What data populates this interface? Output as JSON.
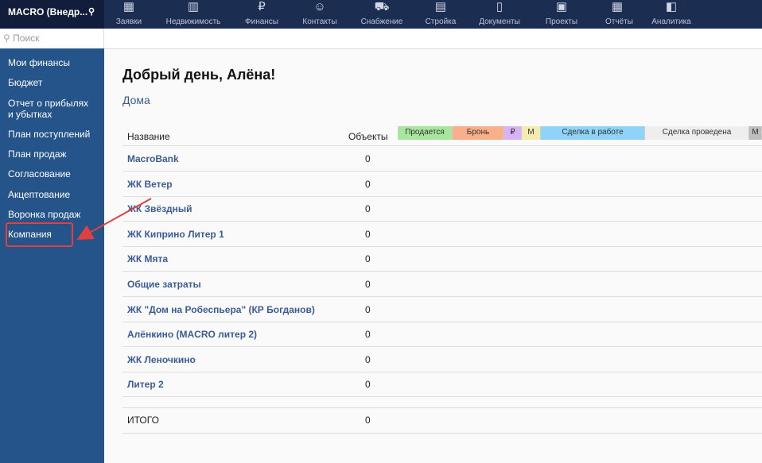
{
  "app": {
    "title": "MACRO (Внедр...",
    "pin_icon": "pin-icon"
  },
  "nav": [
    {
      "label": "Заявки",
      "icon": "grid-icon",
      "glyph": "▦"
    },
    {
      "label": "Недвижимость",
      "icon": "building-icon",
      "glyph": "▥"
    },
    {
      "label": "Финансы",
      "icon": "ruble-icon",
      "glyph": "₽"
    },
    {
      "label": "Контакты",
      "icon": "contacts-icon",
      "glyph": "☺"
    },
    {
      "label": "Снабжение",
      "icon": "truck-icon",
      "glyph": "⛟"
    },
    {
      "label": "Стройка",
      "icon": "bricks-icon",
      "glyph": "▤"
    },
    {
      "label": "Документы",
      "icon": "documents-icon",
      "glyph": "▯"
    },
    {
      "label": "Проекты",
      "icon": "blueprint-icon",
      "glyph": "▣"
    },
    {
      "label": "Отчёты",
      "icon": "reports-icon",
      "glyph": "▦"
    },
    {
      "label": "Аналитика",
      "icon": "analytics-icon",
      "glyph": "◧"
    }
  ],
  "search": {
    "placeholder": "Поиск"
  },
  "sidebar": [
    "Мои финансы",
    "Бюджет",
    "Отчет о прибылях\nи убытках",
    "План поступлений",
    "План продаж",
    "Согласование",
    "Акцептование",
    "Воронка продаж",
    "Компания"
  ],
  "greeting": "Добрый день, Алёна!",
  "section": "Дома",
  "table": {
    "col_name": "Название",
    "col_objects": "Объекты",
    "rows": [
      {
        "name": "MacroBank",
        "value": "0"
      },
      {
        "name": "ЖК Ветер",
        "value": "0"
      },
      {
        "name": "ЖК Звёздный",
        "value": "0"
      },
      {
        "name": "ЖК Киприно Литер 1",
        "value": "0"
      },
      {
        "name": "ЖК Мята",
        "value": "0"
      },
      {
        "name": "Общие затраты",
        "value": "0"
      },
      {
        "name": "ЖК \"Дом на Робеспьера\" (КР Богданов)",
        "value": "0"
      },
      {
        "name": "Алёнкино (MACRO литер 2)",
        "value": "0"
      },
      {
        "name": "ЖК Леночкино",
        "value": "0"
      },
      {
        "name": "Литер 2",
        "value": "0"
      }
    ],
    "total_label": "ИТОГО",
    "total_value": "0"
  },
  "legend": [
    {
      "label": "Продается",
      "color": "#a8e6a0"
    },
    {
      "label": "Бронь",
      "color": "#f9b08a"
    },
    {
      "label": "₽",
      "color": "#d9b3f5"
    },
    {
      "label": "М",
      "color": "#f3ecb0"
    },
    {
      "label": "Сделка в работе",
      "color": "#8fd3f9"
    },
    {
      "label": "Сделка проведена",
      "color": "#eeeeee"
    },
    {
      "label": "М",
      "color": "#bdbdbd"
    }
  ],
  "annotation_color": "#e04040"
}
